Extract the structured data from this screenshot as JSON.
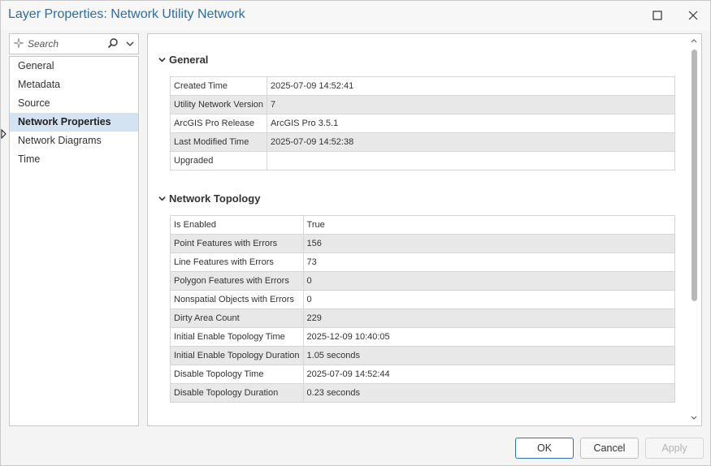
{
  "window": {
    "title": "Layer Properties: Network Utility Network"
  },
  "search": {
    "placeholder": "Search"
  },
  "nav": {
    "items": [
      {
        "label": "General"
      },
      {
        "label": "Metadata"
      },
      {
        "label": "Source"
      },
      {
        "label": "Network Properties",
        "active": true
      },
      {
        "label": "Network Diagrams"
      },
      {
        "label": "Time"
      }
    ]
  },
  "general": {
    "heading": "General",
    "rows": [
      {
        "key": "Created Time",
        "value": "2025-07-09 14:52:41"
      },
      {
        "key": "Utility Network Version",
        "value": "7"
      },
      {
        "key": "ArcGIS Pro Release",
        "value": "ArcGIS Pro 3.5.1"
      },
      {
        "key": "Last Modified Time",
        "value": "2025-07-09 14:52:38"
      },
      {
        "key": "Upgraded",
        "value": ""
      }
    ]
  },
  "topology": {
    "heading": "Network Topology",
    "rows": [
      {
        "key": "Is Enabled",
        "value": "True"
      },
      {
        "key": "Point Features with Errors",
        "value": "156"
      },
      {
        "key": "Line Features with Errors",
        "value": "73"
      },
      {
        "key": "Polygon Features with Errors",
        "value": "0"
      },
      {
        "key": "Nonspatial Objects with Errors",
        "value": "0"
      },
      {
        "key": "Dirty Area Count",
        "value": "229"
      },
      {
        "key": "Initial Enable Topology Time",
        "value": "2025-12-09 10:40:05"
      },
      {
        "key": "Initial Enable Topology Duration",
        "value": "1.05 seconds"
      },
      {
        "key": "Disable Topology Time",
        "value": "2025-07-09 14:52:44"
      },
      {
        "key": "Disable Topology Duration",
        "value": "0.23 seconds"
      }
    ]
  },
  "buttons": {
    "ok": "OK",
    "cancel": "Cancel",
    "apply": "Apply"
  },
  "colors": {
    "title": "#2d6ca8",
    "nav_active_bg": "#d4e3f2",
    "alt_row_bg": "#e8e8e8",
    "ok_border": "#2d74bf"
  }
}
